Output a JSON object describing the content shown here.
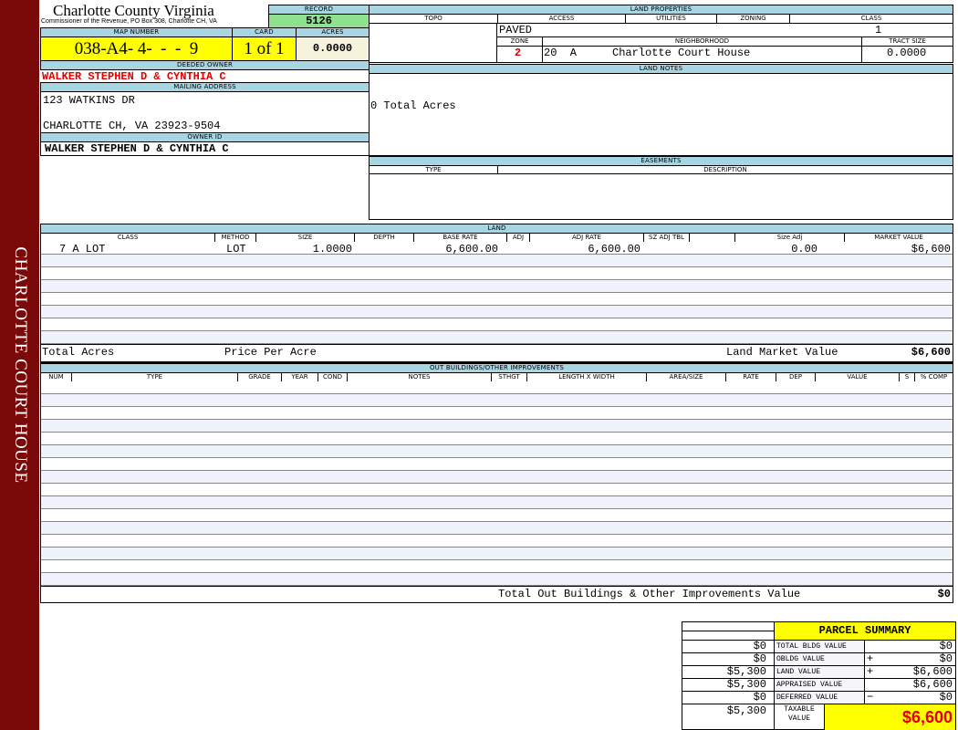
{
  "sidebar": {
    "label": "CHARLOTTE COURT HOUSE",
    "color": "#7a0a0a"
  },
  "header": {
    "title": "Charlotte County Virginia",
    "subtitle": "Commissioner of the Revenue, PO Box 308, Charlotte CH, VA"
  },
  "record": {
    "label": "RECORD",
    "value": "5126"
  },
  "map": {
    "label": "MAP NUMBER",
    "value": "038-A4- 4-  -  -  9",
    "card_label": "CARD",
    "card": "1 of 1",
    "acres_label": "ACRES",
    "acres": "0.0000"
  },
  "owner": {
    "deeded_label": "DEEDED OWNER",
    "deeded": "WALKER STEPHEN D & CYNTHIA C",
    "mailing_label": "MAILING ADDRESS",
    "address1": "123 WATKINS DR",
    "address2": "CHARLOTTE CH, VA 23923-9504",
    "id_label": "OWNER ID",
    "id": "WALKER STEPHEN D & CYNTHIA C"
  },
  "land_props": {
    "title": "LAND PROPERTIES",
    "topo": "TOPO",
    "access": "ACCESS",
    "utilities": "UTILITIES",
    "zoning": "ZONING",
    "class": "CLASS",
    "access_val": "PAVED",
    "class_val": "1",
    "zone_label": "ZONE",
    "neighborhood_label": "NEIGHBORHOOD",
    "tract_label": "TRACT SIZE",
    "zone": "2",
    "neighborhood_code": "20  A",
    "neighborhood": "Charlotte Court House",
    "tract": "0.0000"
  },
  "land_notes": {
    "title": "LAND NOTES",
    "text": "0 Total Acres"
  },
  "easements": {
    "title": "EASEMENTS",
    "type": "TYPE",
    "description": "DESCRIPTION"
  },
  "land": {
    "title": "LAND",
    "columns": [
      "CLASS",
      "METHOD",
      "SIZE",
      "DEPTH",
      "BASE RATE",
      "ADJ",
      "ADJ RATE",
      "SZ ADJ TBL",
      "",
      "Size Adj",
      "MARKET VALUE"
    ],
    "row": {
      "class": "7 A LOT",
      "method": "LOT",
      "size": "1.0000",
      "base_rate": "6,600.00",
      "adj_rate": "6,600.00",
      "size_adj": "0.00",
      "market": "$6,600"
    },
    "total_acres": "Total Acres",
    "price_per_acre": "Price Per Acre",
    "market_label": "Land Market Value",
    "market_total": "$6,600"
  },
  "outbuildings": {
    "title": "OUT BUILDINGS/OTHER IMPROVEMENTS",
    "columns": [
      "NUM",
      "TYPE",
      "GRADE",
      "YEAR",
      "COND",
      "NOTES",
      "STHGT",
      "LENGTH X WIDTH",
      "AREA/SIZE",
      "RATE",
      "DEP",
      "VALUE",
      "S",
      "% COMP"
    ],
    "total_label": "Total Out Buildings & Other Improvements Value",
    "total": "$0"
  },
  "summary": {
    "title": "PARCEL SUMMARY",
    "rows": [
      {
        "prior": "$0",
        "label": "TOTAL BLDG VALUE",
        "sign": "",
        "value": "$0"
      },
      {
        "prior": "$0",
        "label": "OBLDG VALUE",
        "sign": "+",
        "value": "$0"
      },
      {
        "prior": "$5,300",
        "label": "LAND VALUE",
        "sign": "+",
        "value": "$6,600"
      },
      {
        "prior": "$5,300",
        "label": "APPRAISED VALUE",
        "sign": "",
        "value": "$6,600"
      },
      {
        "prior": "$0",
        "label": "DEFERRED VALUE",
        "sign": "−",
        "value": "$0"
      }
    ],
    "taxable_prior": "$5,300",
    "taxable_label": "TAXABLE VALUE",
    "taxable": "$6,600"
  }
}
